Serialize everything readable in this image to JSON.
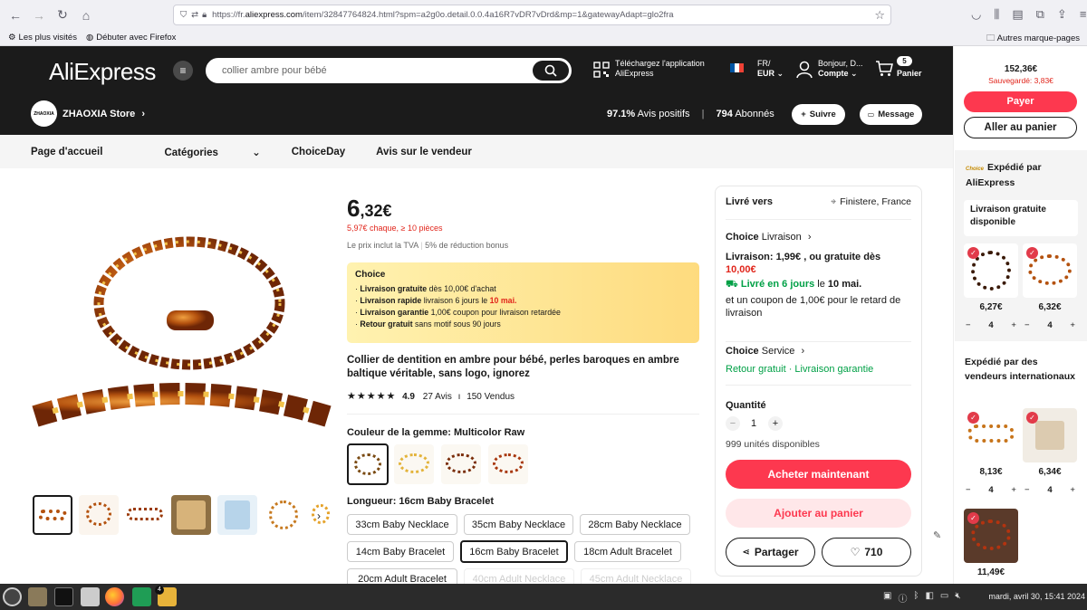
{
  "browser": {
    "url_prefix": "https://fr.",
    "url_host": "aliexpress.com",
    "url_path": "/item/32847764824.html?spm=a2g0o.detail.0.0.4a16R7vDR7vDrd&mp=1&gatewayAdapt=glo2fra",
    "bookmarks": [
      "Les plus visités",
      "Débuter avec Firefox"
    ],
    "other_bookmarks": "Autres marque-pages"
  },
  "header": {
    "logo": "AliExpress",
    "search_value": "collier ambre pour bébé",
    "app_line1": "Téléchargez l'application",
    "app_line2": "AliExpress",
    "lang": "FR/",
    "currency": "EUR",
    "account_line1": "Bonjour, D...",
    "account_line2": "Compte",
    "cart_count": "5",
    "cart_label": "Panier"
  },
  "store": {
    "badge": "ZHAOXIA",
    "name": "ZHAOXIA Store",
    "positive_value": "97.1%",
    "positive_label": "Avis positifs",
    "followers_value": "794",
    "followers_label": "Abonnés",
    "follow_label": "Suivre",
    "message_label": "Message"
  },
  "nav": [
    "Page d'accueil",
    "Catégories",
    "ChoiceDay",
    "Avis sur le vendeur"
  ],
  "product": {
    "price_int": "6",
    "price_dec": ",32€",
    "bulk_price": "5,97€ chaque, ≥ 10 pièces",
    "tax_note": "Le prix inclut la TVA",
    "bonus_note": "5% de réduction bonus",
    "choice_title": "Choice",
    "choice_lines": [
      {
        "bold": "Livraison gratuite",
        "text": " dès 10,00€ d'achat",
        "red": ""
      },
      {
        "bold": "Livraison rapide",
        "text": "  livraison 6 jours le ",
        "red": "10 mai."
      },
      {
        "bold": "Livraison garantie",
        "text": "  1,00€ coupon pour livraison retardée",
        "red": ""
      },
      {
        "bold": "Retour gratuit",
        "text": "  sans motif sous 90 jours",
        "red": ""
      }
    ],
    "title": "Collier de dentition en ambre pour bébé, perles baroques en ambre baltique véritable, sans logo, ignorez",
    "rating": "4.9",
    "reviews": "27 Avis",
    "sold": "150 Vendus",
    "color_label": "Couleur de la gemme: Multicolor Raw",
    "length_label": "Longueur: 16cm Baby Bracelet",
    "lengths": [
      "33cm Baby Necklace",
      "35cm Baby Necklace",
      "28cm Baby Necklace",
      "14cm Baby Bracelet",
      "16cm Baby Bracelet",
      "18cm Adult Bracelet",
      "20cm Adult Bracelet",
      "40cm Adult Necklace",
      "45cm Adult Necklace"
    ]
  },
  "delivery": {
    "ship_to_label": "Livré vers",
    "ship_to_value": "Finistere, France",
    "choice_word": "Choice",
    "livraison_label": "Livraison",
    "shipping_line_a": "Livraison: 1,99€ , ou gratuite dès",
    "shipping_line_b": "10,00€",
    "fast_green": "Livré en 6 jours",
    "fast_rest": " le ",
    "fast_date": "10 mai.",
    "coupon_line": "et un coupon de 1,00€ pour le retard de livraison",
    "service_label": "Service",
    "service_links": "Retour gratuit · Livraison garantie",
    "quantity_label": "Quantité",
    "quantity_value": "1",
    "stock": "999 unités disponibles",
    "buy_now": "Acheter maintenant",
    "add_cart": "Ajouter au panier",
    "share": "Partager",
    "likes": "710"
  },
  "cart_side": {
    "total": "152,36€",
    "saved": "Sauvegardé: 3,83€",
    "pay": "Payer",
    "go_cart": "Aller au panier",
    "choice_small": "Choice",
    "shipped_by_ae": "Expédié par AliExpress",
    "free_ship": "Livraison gratuite disponible",
    "items_choice": [
      {
        "price": "6,27€",
        "qty": "4"
      },
      {
        "price": "6,32€",
        "qty": "4"
      }
    ],
    "intl_title": "Expédié par des vendeurs internationaux",
    "items_intl": [
      {
        "price": "8,13€",
        "qty": "4"
      },
      {
        "price": "6,34€",
        "qty": "4"
      },
      {
        "price": "11,49€",
        "qty": ""
      }
    ]
  },
  "taskbar": {
    "badge": "4",
    "clock": "mardi, avril 30, 15:41 2024"
  },
  "colors": {
    "brand_red": "#fd384f",
    "green": "#00a046",
    "choice_yellow": "#fee68a"
  }
}
